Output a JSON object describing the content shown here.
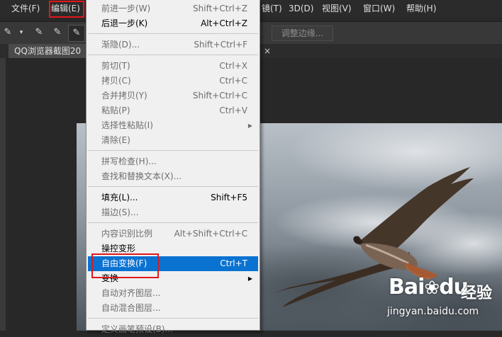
{
  "menubar": {
    "items": [
      {
        "label": "文件(F)"
      },
      {
        "label": "编辑(E)"
      },
      {
        "label": "镜(T)"
      },
      {
        "label": "3D(D)"
      },
      {
        "label": "视图(V)"
      },
      {
        "label": "窗口(W)"
      },
      {
        "label": "帮助(H)"
      }
    ]
  },
  "options_bar": {
    "refine_edge_label": "调整边缘..."
  },
  "document": {
    "tab_title": "QQ浏览器截图20",
    "tab_close": "×"
  },
  "edit_menu": {
    "items": [
      {
        "label": "前进一步(W)",
        "shortcut": "Shift+Ctrl+Z"
      },
      {
        "label": "后退一步(K)",
        "shortcut": "Alt+Ctrl+Z"
      },
      {
        "label": "渐隐(D)...",
        "shortcut": "Shift+Ctrl+F"
      },
      {
        "label": "剪切(T)",
        "shortcut": "Ctrl+X"
      },
      {
        "label": "拷贝(C)",
        "shortcut": "Ctrl+C"
      },
      {
        "label": "合并拷贝(Y)",
        "shortcut": "Shift+Ctrl+C"
      },
      {
        "label": "粘贴(P)",
        "shortcut": "Ctrl+V"
      },
      {
        "label": "选择性粘贴(I)",
        "shortcut": ""
      },
      {
        "label": "清除(E)",
        "shortcut": ""
      },
      {
        "label": "拼写检查(H)...",
        "shortcut": ""
      },
      {
        "label": "查找和替换文本(X)...",
        "shortcut": ""
      },
      {
        "label": "填充(L)...",
        "shortcut": "Shift+F5"
      },
      {
        "label": "描边(S)...",
        "shortcut": ""
      },
      {
        "label": "内容识别比例",
        "shortcut": "Alt+Shift+Ctrl+C"
      },
      {
        "label": "操控变形",
        "shortcut": ""
      },
      {
        "label": "自由变换(F)",
        "shortcut": "Ctrl+T"
      },
      {
        "label": "变换",
        "shortcut": ""
      },
      {
        "label": "自动对齐图层...",
        "shortcut": ""
      },
      {
        "label": "自动混合图层...",
        "shortcut": ""
      },
      {
        "label": "定义画笔预设(B)...",
        "shortcut": ""
      }
    ]
  },
  "watermark": {
    "brand": "Bai",
    "brand_suffix": "du",
    "cn": "经验",
    "url": "jingyan.baidu.com"
  },
  "colors": {
    "highlight": "#0a72d1",
    "annotation_red": "#e3161b"
  }
}
